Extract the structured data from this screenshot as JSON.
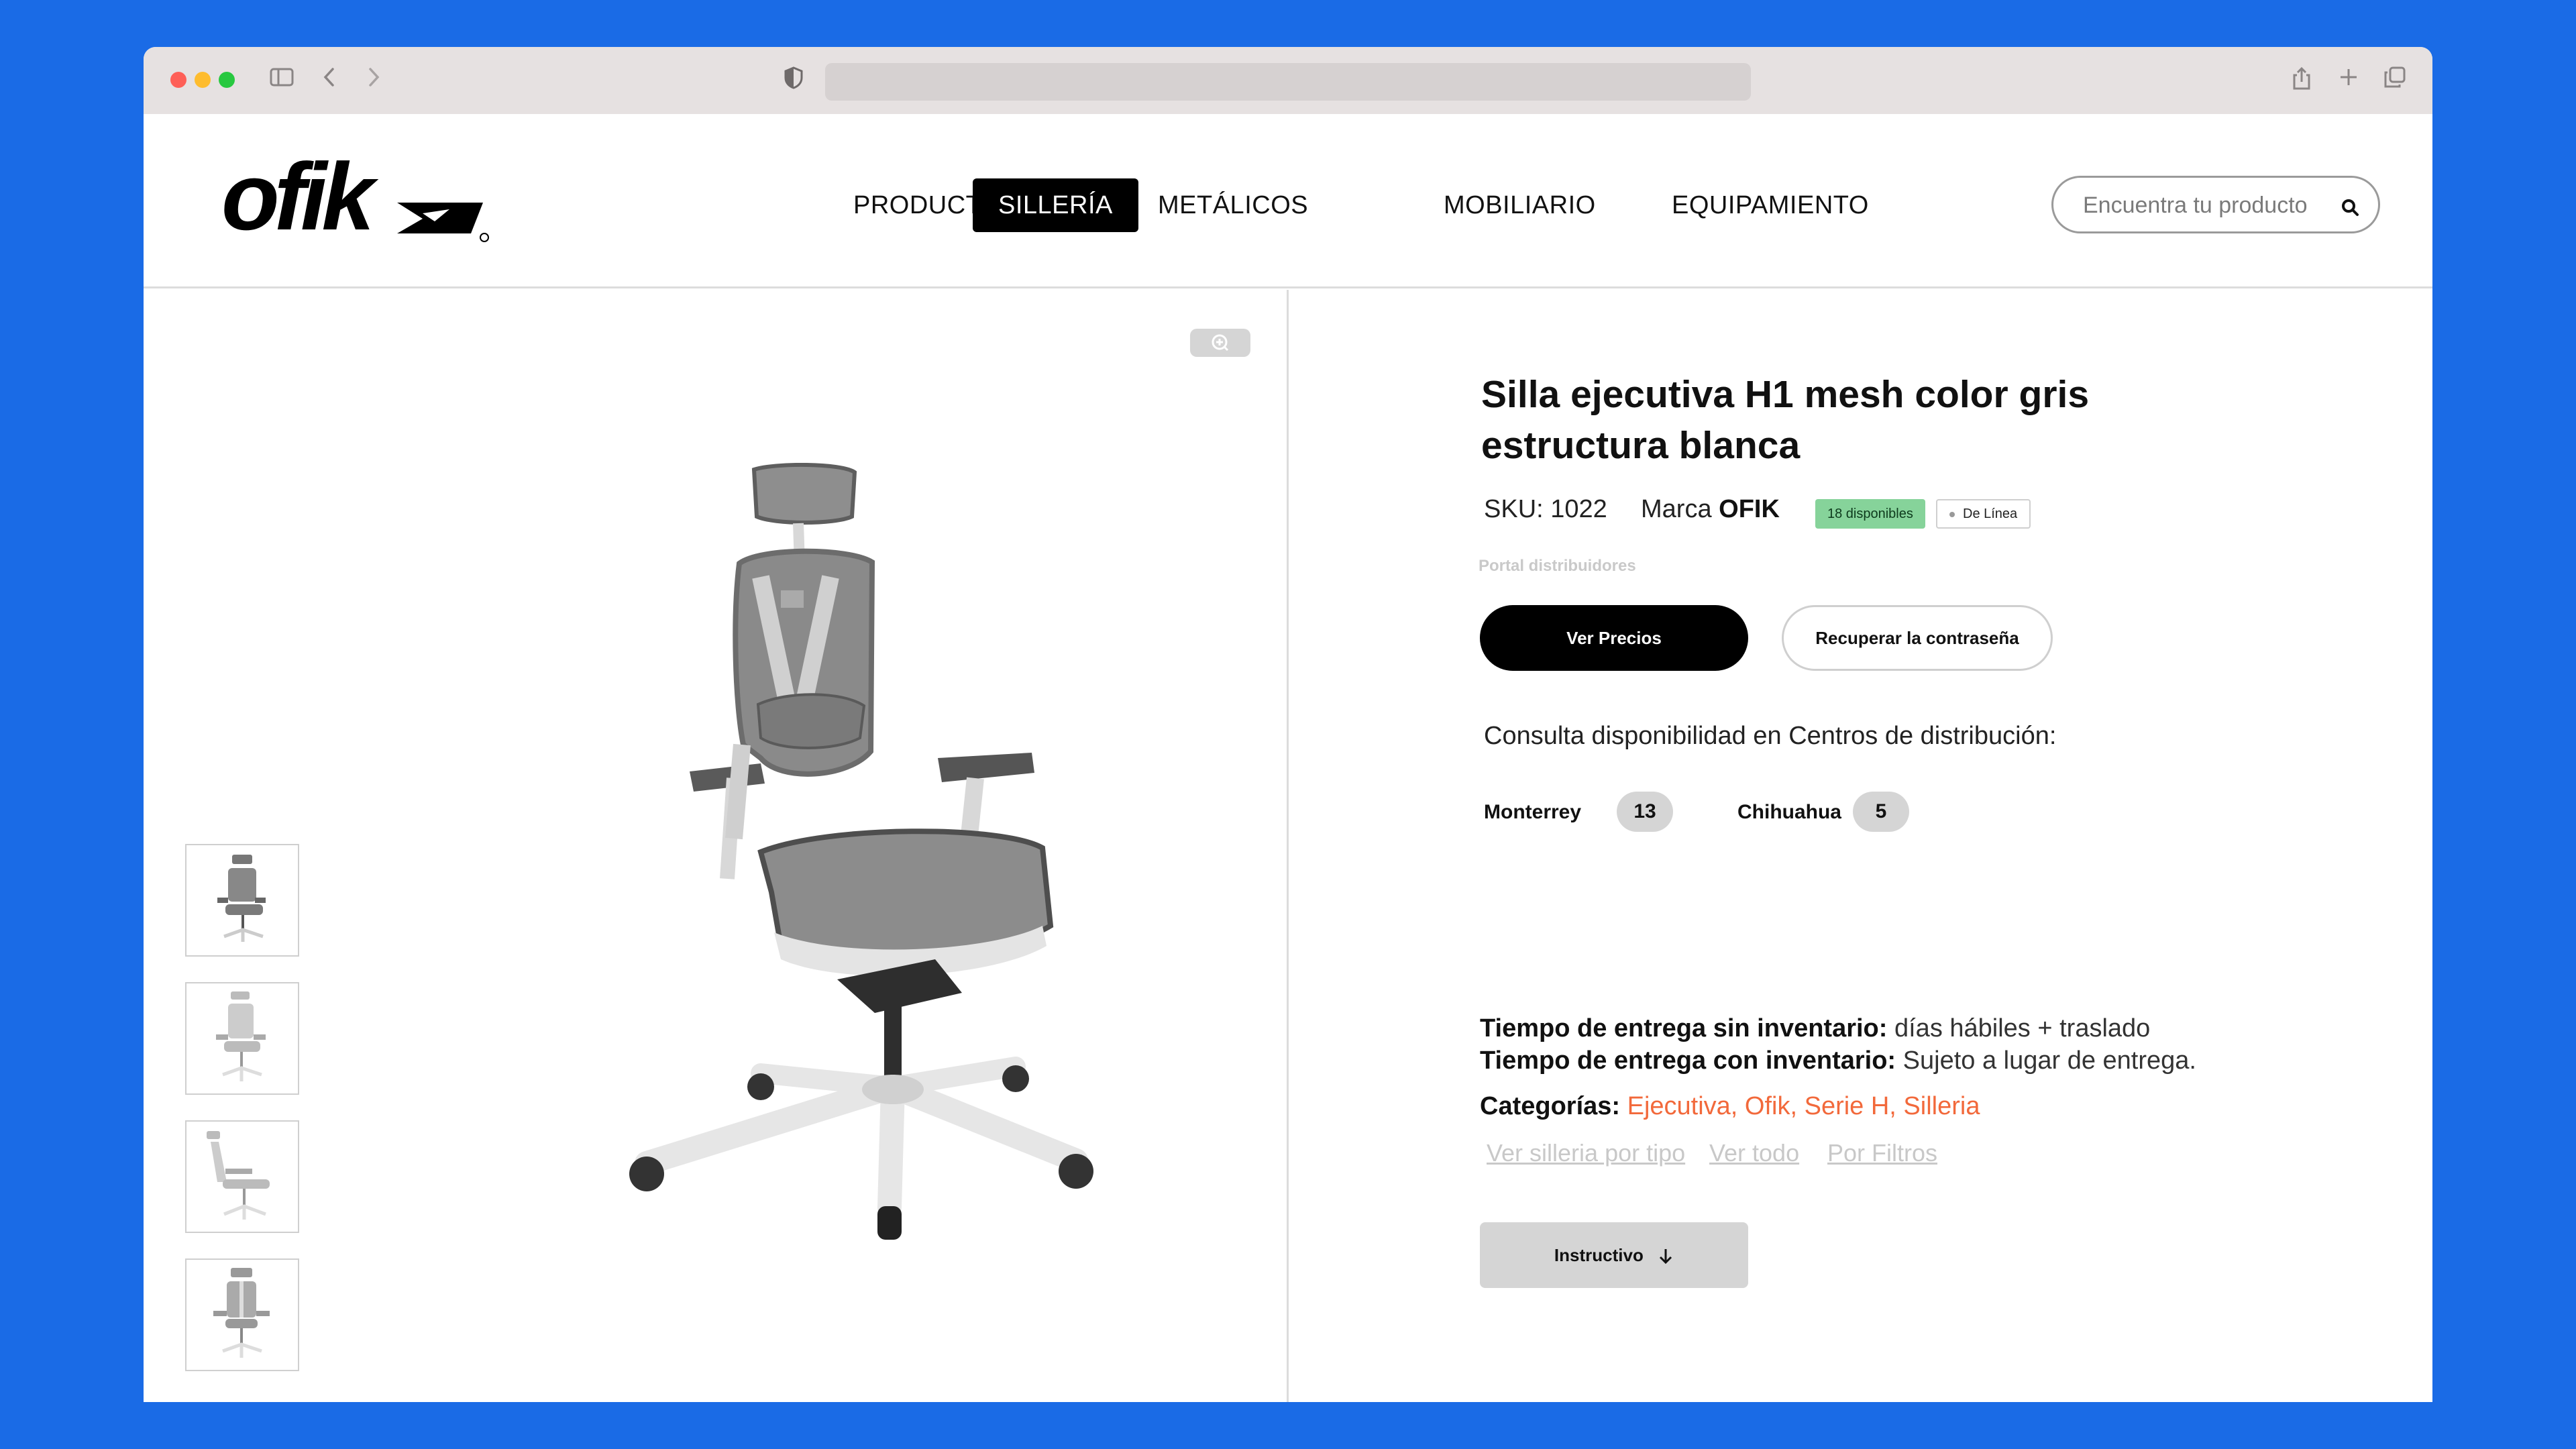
{
  "nav": {
    "items": [
      "PRODUCTOS",
      "SILLERÍA",
      "METÁLICOS",
      "MOBILIARIO",
      "EQUIPAMIENTO"
    ],
    "active": "SILLERÍA"
  },
  "search": {
    "placeholder": "Encuentra tu producto"
  },
  "product": {
    "title": "Silla ejecutiva H1 mesh color gris estructura blanca",
    "sku": "SKU: 1022",
    "brand_label": "Marca",
    "brand": "OFIK",
    "stock_badge": "18 disponibles",
    "line_badge": "De Línea",
    "portal_label": "Portal distribuidores",
    "btn_prices": "Ver Precios",
    "btn_recover": "Recuperar la contraseña",
    "availability_title": "Consulta disponibilidad en Centros de distribución:",
    "centers": [
      {
        "name": "Monterrey",
        "qty": "13"
      },
      {
        "name": "Chihuahua",
        "qty": "5"
      }
    ],
    "delivery_no_stock_label": "Tiempo de entrega sin inventario:",
    "delivery_no_stock_value": " días hábiles + traslado",
    "delivery_stock_label": "Tiempo de entrega con inventario:",
    "delivery_stock_value": " Sujeto a lugar de entrega.",
    "categories_label": "Categorías:",
    "categories": " Ejecutiva, Ofik, Serie H, Silleria",
    "sublinks": [
      "Ver silleria por tipo",
      "Ver todo",
      "Por Filtros"
    ],
    "btn_manual": "Instructivo"
  },
  "colors": {
    "background": "#1a6be6",
    "accent": "#f2693b",
    "stock_green": "#86d39a"
  }
}
